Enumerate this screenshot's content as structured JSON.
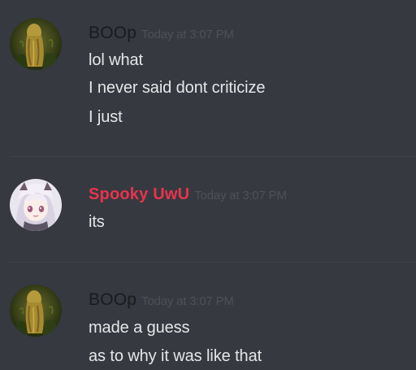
{
  "messages": [
    {
      "author": "BOOp",
      "timestamp": "Today at 3:07 PM",
      "avatar": "moss-figure-avatar",
      "lines": [
        "lol what",
        "I never said dont criticize",
        "I just"
      ]
    },
    {
      "author": "Spooky UwU",
      "timestamp": "Today at 3:07 PM",
      "avatar": "anime-girl-avatar",
      "lines": [
        "its"
      ]
    },
    {
      "author": "BOOp",
      "timestamp": "Today at 3:07 PM",
      "avatar": "moss-figure-avatar",
      "lines": [
        "made a guess",
        "as to why it was like that"
      ]
    }
  ],
  "colors": {
    "background": "#36393f",
    "boop_name": "#1a1b1e",
    "spooky_name": "#e8344e",
    "timestamp": "#4e5157",
    "message_text": "#e6e7e8"
  }
}
